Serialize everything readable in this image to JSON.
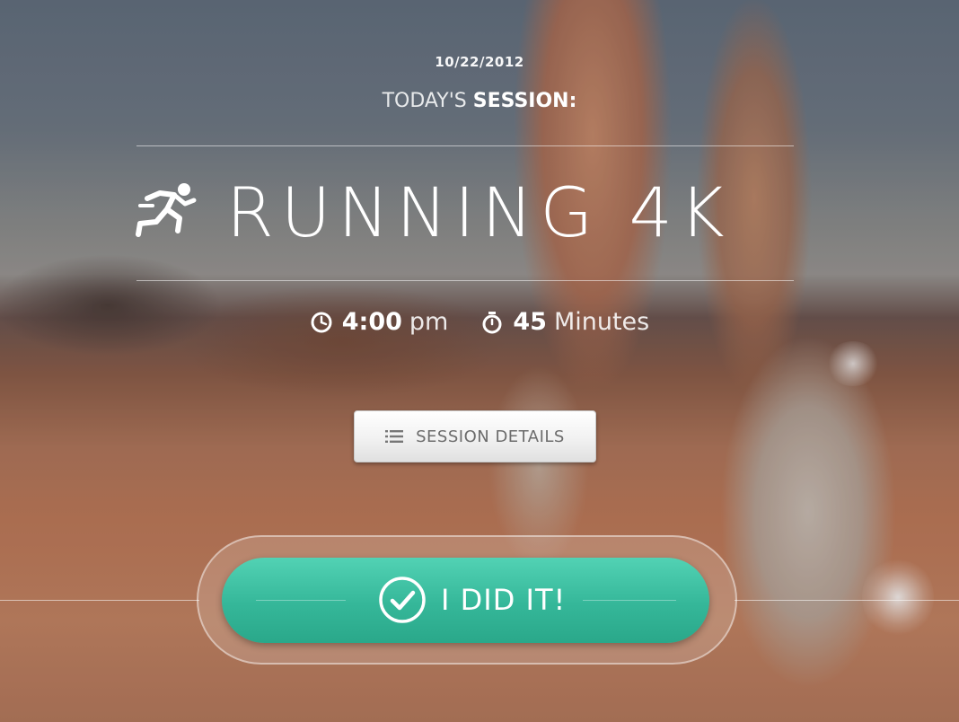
{
  "session": {
    "date": "10/22/2012",
    "heading_light": "TODAY'S ",
    "heading_bold": "SESSION:",
    "title": "RUNNING 4K",
    "activity_icon": "runner-icon",
    "time": {
      "icon": "clock-icon",
      "value": "4:00",
      "unit": "pm"
    },
    "duration": {
      "icon": "stopwatch-icon",
      "value": "45",
      "unit": "Minutes"
    }
  },
  "actions": {
    "details": {
      "icon": "list-icon",
      "label": "SESSION DETAILS"
    },
    "complete": {
      "icon": "check-circle-icon",
      "label": "I DID IT!"
    }
  },
  "colors": {
    "accent": "#38b99b",
    "button_light": "#f1f1f1",
    "button_text": "#6c6c6c"
  }
}
